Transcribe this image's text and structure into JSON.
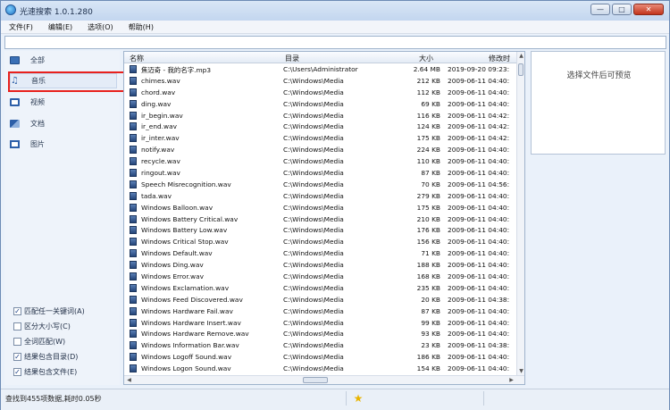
{
  "window": {
    "title": "光速搜索 1.0.1.280",
    "buttons": {
      "minimize": "—",
      "maximize": "□",
      "close": "✕"
    }
  },
  "menu": [
    {
      "label": "文件(F)"
    },
    {
      "label": "编辑(E)"
    },
    {
      "label": "选项(O)"
    },
    {
      "label": "帮助(H)"
    }
  ],
  "search": {
    "value": "",
    "placeholder": ""
  },
  "sidebar": {
    "categories": [
      {
        "label": "全部",
        "icon": "all-files-icon",
        "color": "#3a6fb5"
      },
      {
        "label": "音乐",
        "icon": "music-icon",
        "color": "#2d5fa8"
      },
      {
        "label": "视频",
        "icon": "video-icon",
        "color": "#2d5fa8"
      },
      {
        "label": "文档",
        "icon": "document-icon",
        "color": "#2d5fa8"
      },
      {
        "label": "图片",
        "icon": "picture-icon",
        "color": "#2d5fa8"
      }
    ],
    "selected_index": 1,
    "options": [
      {
        "label": "匹配任一关键词(A)",
        "checked": true
      },
      {
        "label": "区分大小写(C)",
        "checked": false
      },
      {
        "label": "全词匹配(W)",
        "checked": false
      },
      {
        "label": "结果包含目录(D)",
        "checked": true
      },
      {
        "label": "结果包含文件(E)",
        "checked": true
      }
    ]
  },
  "table": {
    "columns": {
      "name": "名称",
      "path": "目录",
      "size": "大小",
      "date": "修改时"
    },
    "rows": [
      {
        "name": "焦迈奇 - 我的名字.mp3",
        "path": "C:\\Users\\Administrator",
        "size": "2.64 MB",
        "date": "2019-09-20 09:23:"
      },
      {
        "name": "chimes.wav",
        "path": "C:\\Windows\\Media",
        "size": "212 KB",
        "date": "2009-06-11 04:40:"
      },
      {
        "name": "chord.wav",
        "path": "C:\\Windows\\Media",
        "size": "112 KB",
        "date": "2009-06-11 04:40:"
      },
      {
        "name": "ding.wav",
        "path": "C:\\Windows\\Media",
        "size": "69 KB",
        "date": "2009-06-11 04:40:"
      },
      {
        "name": "ir_begin.wav",
        "path": "C:\\Windows\\Media",
        "size": "116 KB",
        "date": "2009-06-11 04:42:"
      },
      {
        "name": "ir_end.wav",
        "path": "C:\\Windows\\Media",
        "size": "124 KB",
        "date": "2009-06-11 04:42:"
      },
      {
        "name": "ir_inter.wav",
        "path": "C:\\Windows\\Media",
        "size": "175 KB",
        "date": "2009-06-11 04:42:"
      },
      {
        "name": "notify.wav",
        "path": "C:\\Windows\\Media",
        "size": "224 KB",
        "date": "2009-06-11 04:40:"
      },
      {
        "name": "recycle.wav",
        "path": "C:\\Windows\\Media",
        "size": "110 KB",
        "date": "2009-06-11 04:40:"
      },
      {
        "name": "ringout.wav",
        "path": "C:\\Windows\\Media",
        "size": "87 KB",
        "date": "2009-06-11 04:40:"
      },
      {
        "name": "Speech Misrecognition.wav",
        "path": "C:\\Windows\\Media",
        "size": "70 KB",
        "date": "2009-06-11 04:56:"
      },
      {
        "name": "tada.wav",
        "path": "C:\\Windows\\Media",
        "size": "279 KB",
        "date": "2009-06-11 04:40:"
      },
      {
        "name": "Windows Balloon.wav",
        "path": "C:\\Windows\\Media",
        "size": "175 KB",
        "date": "2009-06-11 04:40:"
      },
      {
        "name": "Windows Battery Critical.wav",
        "path": "C:\\Windows\\Media",
        "size": "210 KB",
        "date": "2009-06-11 04:40:"
      },
      {
        "name": "Windows Battery Low.wav",
        "path": "C:\\Windows\\Media",
        "size": "176 KB",
        "date": "2009-06-11 04:40:"
      },
      {
        "name": "Windows Critical Stop.wav",
        "path": "C:\\Windows\\Media",
        "size": "156 KB",
        "date": "2009-06-11 04:40:"
      },
      {
        "name": "Windows Default.wav",
        "path": "C:\\Windows\\Media",
        "size": "71 KB",
        "date": "2009-06-11 04:40:"
      },
      {
        "name": "Windows Ding.wav",
        "path": "C:\\Windows\\Media",
        "size": "188 KB",
        "date": "2009-06-11 04:40:"
      },
      {
        "name": "Windows Error.wav",
        "path": "C:\\Windows\\Media",
        "size": "168 KB",
        "date": "2009-06-11 04:40:"
      },
      {
        "name": "Windows Exclamation.wav",
        "path": "C:\\Windows\\Media",
        "size": "235 KB",
        "date": "2009-06-11 04:40:"
      },
      {
        "name": "Windows Feed Discovered.wav",
        "path": "C:\\Windows\\Media",
        "size": "20 KB",
        "date": "2009-06-11 04:38:"
      },
      {
        "name": "Windows Hardware Fail.wav",
        "path": "C:\\Windows\\Media",
        "size": "87 KB",
        "date": "2009-06-11 04:40:"
      },
      {
        "name": "Windows Hardware Insert.wav",
        "path": "C:\\Windows\\Media",
        "size": "99 KB",
        "date": "2009-06-11 04:40:"
      },
      {
        "name": "Windows Hardware Remove.wav",
        "path": "C:\\Windows\\Media",
        "size": "93 KB",
        "date": "2009-06-11 04:40:"
      },
      {
        "name": "Windows Information Bar.wav",
        "path": "C:\\Windows\\Media",
        "size": "23 KB",
        "date": "2009-06-11 04:38:"
      },
      {
        "name": "Windows Logoff Sound.wav",
        "path": "C:\\Windows\\Media",
        "size": "186 KB",
        "date": "2009-06-11 04:40:"
      },
      {
        "name": "Windows Logon Sound.wav",
        "path": "C:\\Windows\\Media",
        "size": "154 KB",
        "date": "2009-06-11 04:40:"
      }
    ]
  },
  "preview": {
    "text": "选择文件后可预览"
  },
  "status": {
    "text": "查找到455项数据,耗时0.05秒",
    "icon": "star-icon"
  }
}
